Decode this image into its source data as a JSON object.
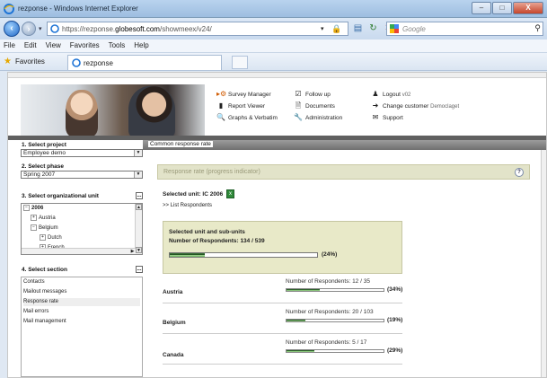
{
  "window": {
    "title": "rezponse - Windows Internet Explorer",
    "buttons": {
      "minimize": "–",
      "maximize": "□",
      "close": "X"
    }
  },
  "addressbar": {
    "url_prefix": "https://rezponse.",
    "url_domain": "globesoft.com",
    "url_suffix": "/showmeex/v24/",
    "search_placeholder": "Google"
  },
  "menu": [
    "File",
    "Edit",
    "View",
    "Favorites",
    "Tools",
    "Help"
  ],
  "favorites": {
    "label": "Favorites",
    "tab_title": "rezponse"
  },
  "nav": {
    "survey_manager": "Survey Manager",
    "report_viewer": "Report Viewer",
    "graphs_verbatim": "Graphs & Verbatim",
    "follow_up": "Follow up",
    "documents": "Documents",
    "administration": "Administration",
    "logout": "Logout",
    "logout_user": "v02",
    "change_customer": "Change customer",
    "customer_name": "Democlaget",
    "support": "Support"
  },
  "sidebar": {
    "project_label": "1. Select project",
    "project_value": "Employee demo",
    "phase_label": "2. Select phase",
    "phase_value": "Spring 2007",
    "org_label": "3. Select organizational unit",
    "tree": [
      "2006",
      "Austria",
      "Belgium",
      "Dutch",
      "French"
    ],
    "section_label": "4. Select section",
    "sections": [
      "Contacts",
      "Mailout messages",
      "Response rate",
      "Mail errors",
      "Mail management"
    ],
    "active_section": "Response rate",
    "ellipsis": "..."
  },
  "main": {
    "breadcrumb": "Common response rate",
    "panel_title": "Response rate (progress indicator)",
    "help": "?",
    "selected_unit": "Selected unit: IC 2006",
    "list_link": ">> List Respondents",
    "summary_title": "Selected unit and sub-units",
    "summary_count": "Number of Respondents: 134 / 539",
    "summary_pct_label": "(24%)",
    "summary_pct": 0.24,
    "rows": [
      {
        "country": "Austria",
        "respondents": "Number of Respondents: 12 / 35",
        "pct_label": "(34%)",
        "pct": 0.34
      },
      {
        "country": "Belgium",
        "respondents": "Number of Respondents: 20 / 103",
        "pct_label": "(19%)",
        "pct": 0.19
      },
      {
        "country": "Canada",
        "respondents": "Number of Respondents: 5 / 17",
        "pct_label": "(29%)",
        "pct": 0.29
      }
    ]
  }
}
